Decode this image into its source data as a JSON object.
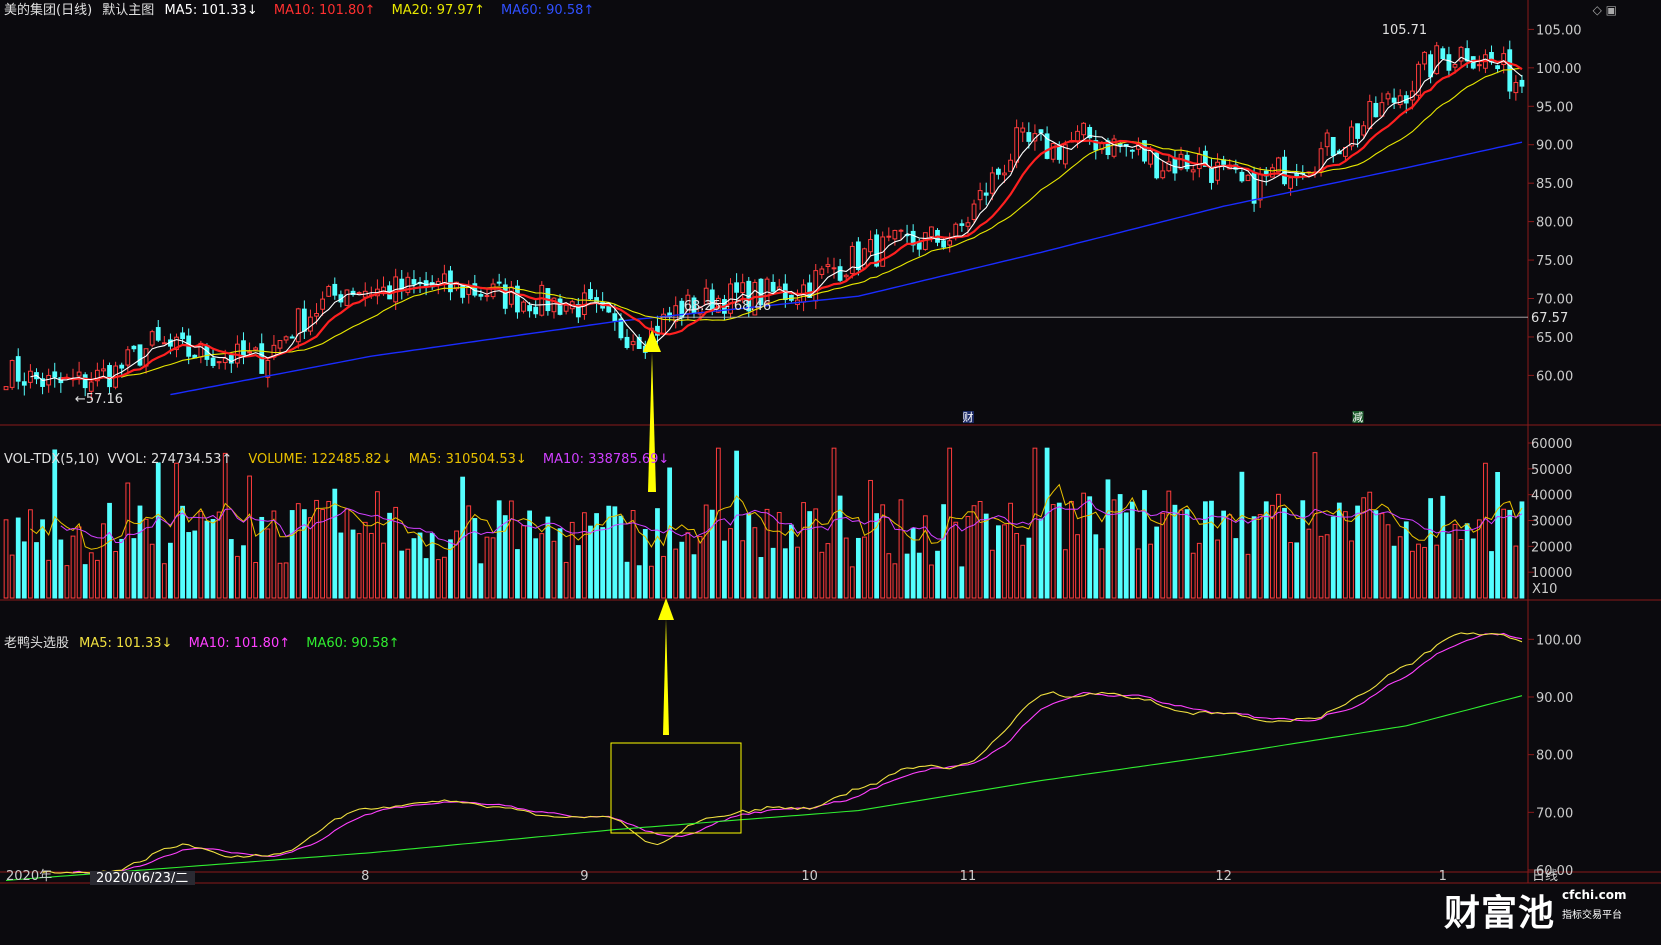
{
  "header": {
    "stock": "美的集团(日线)",
    "main_label": "默认主图",
    "ma5": "MA5: 101.33↓",
    "ma10": "MA10: 101.80↑",
    "ma20": "MA20: 97.97↑",
    "ma60": "MA60: 90.58↑"
  },
  "volume_header": {
    "indicator": "VOL-TDX(5,10)",
    "vvol": "VVOL: 274734.53↑",
    "volume": "VOLUME: 122485.82↓",
    "ma5": "MA5: 310504.53↓",
    "ma10": "MA10: 338785.69↓"
  },
  "ind_header": {
    "name": "老鸭头选股",
    "ma5": "MA5: 101.33↓",
    "ma10": "MA10: 101.80↑",
    "ma60": "MA60: 90.58↑"
  },
  "colors": {
    "up": "#ff3c3c",
    "down": "#54ffff",
    "ma5": "#ffffff",
    "ma10": "#ff2020",
    "ma20": "#e8e800",
    "ma60": "#1a2cff",
    "ind_ma5": "#f0e040",
    "ind_ma10": "#ff40ff",
    "ind_ma60": "#30ee30",
    "annotation": "#ffff00"
  },
  "chart_data": [
    {
      "type": "candlestick",
      "title": "美的集团(日线)",
      "ylim": [
        55.5,
        105.7
      ],
      "yticks": [
        "105.00",
        "100.00",
        "95.00",
        "90.00",
        "85.00",
        "80.00",
        "75.00",
        "70.00",
        "65.00",
        "60.00"
      ],
      "ytick_values": [
        105,
        100,
        95,
        90,
        85,
        80,
        75,
        70,
        65,
        60
      ],
      "xticks": [
        "2020年",
        "8",
        "9",
        "10",
        "11",
        "12",
        "1",
        "日线"
      ],
      "xtick_positions": [
        0,
        59,
        95,
        132,
        158,
        200,
        236,
        250
      ],
      "date_label": "2020/06/23/二",
      "last_price_label": "67.57",
      "last_price": 67.57,
      "annotations": {
        "high": "105.71",
        "high_value": 105.71,
        "low": "57.16",
        "low_value": 57.16,
        "range": "68.25 - 68.46",
        "range_value": 68.25,
        "marker_cai": "财",
        "marker_jian": "减"
      },
      "anchors": [
        [
          0,
          60.5
        ],
        [
          8,
          58.8
        ],
        [
          12,
          59.2
        ],
        [
          18,
          60.5
        ],
        [
          24,
          64
        ],
        [
          30,
          63
        ],
        [
          36,
          62.5
        ],
        [
          42,
          62
        ],
        [
          48,
          67
        ],
        [
          56,
          71.5
        ],
        [
          62,
          71
        ],
        [
          70,
          71.5
        ],
        [
          78,
          71
        ],
        [
          84,
          70
        ],
        [
          90,
          69.5
        ],
        [
          95,
          69
        ],
        [
          100,
          66
        ],
        [
          105,
          65
        ],
        [
          110,
          68.3
        ],
        [
          116,
          70
        ],
        [
          124,
          70.5
        ],
        [
          130,
          71
        ],
        [
          136,
          74
        ],
        [
          142,
          76
        ],
        [
          150,
          77.5
        ],
        [
          156,
          78
        ],
        [
          160,
          83
        ],
        [
          166,
          90
        ],
        [
          172,
          89.5
        ],
        [
          178,
          91
        ],
        [
          184,
          89.5
        ],
        [
          190,
          87.5
        ],
        [
          196,
          88
        ],
        [
          204,
          84
        ],
        [
          210,
          87
        ],
        [
          216,
          89
        ],
        [
          222,
          92
        ],
        [
          228,
          96
        ],
        [
          234,
          100.5
        ],
        [
          240,
          102.5
        ],
        [
          244,
          100.5
        ],
        [
          248,
          98.5
        ]
      ],
      "ma60_anchors": [
        [
          27,
          57.5
        ],
        [
          60,
          62.5
        ],
        [
          100,
          67
        ],
        [
          140,
          70.3
        ],
        [
          170,
          76
        ],
        [
          200,
          82
        ],
        [
          230,
          87
        ],
        [
          250,
          90.5
        ]
      ]
    },
    {
      "type": "bar",
      "title": "VOL-TDX(5,10)",
      "ylim": [
        0,
        60000
      ],
      "yticks": [
        "60000",
        "50000",
        "40000",
        "30000",
        "20000",
        "10000"
      ],
      "ytick_values": [
        60000,
        50000,
        40000,
        30000,
        20000,
        10000
      ],
      "unit_label": "X10"
    },
    {
      "type": "line",
      "title": "老鸭头选股",
      "ylim": [
        60,
        103
      ],
      "yticks": [
        "100.00",
        "90.00",
        "80.00",
        "70.00",
        "60.00"
      ],
      "ytick_values": [
        100,
        90,
        80,
        70,
        60
      ],
      "series": [
        {
          "name": "MA5",
          "color": "#f0e040"
        },
        {
          "name": "MA10",
          "color": "#ff40ff"
        },
        {
          "name": "MA60",
          "color": "#30ee30"
        }
      ]
    }
  ],
  "logo": {
    "big": "财富池",
    "domain": "cfchi.com",
    "sub": "指标交易平台"
  }
}
